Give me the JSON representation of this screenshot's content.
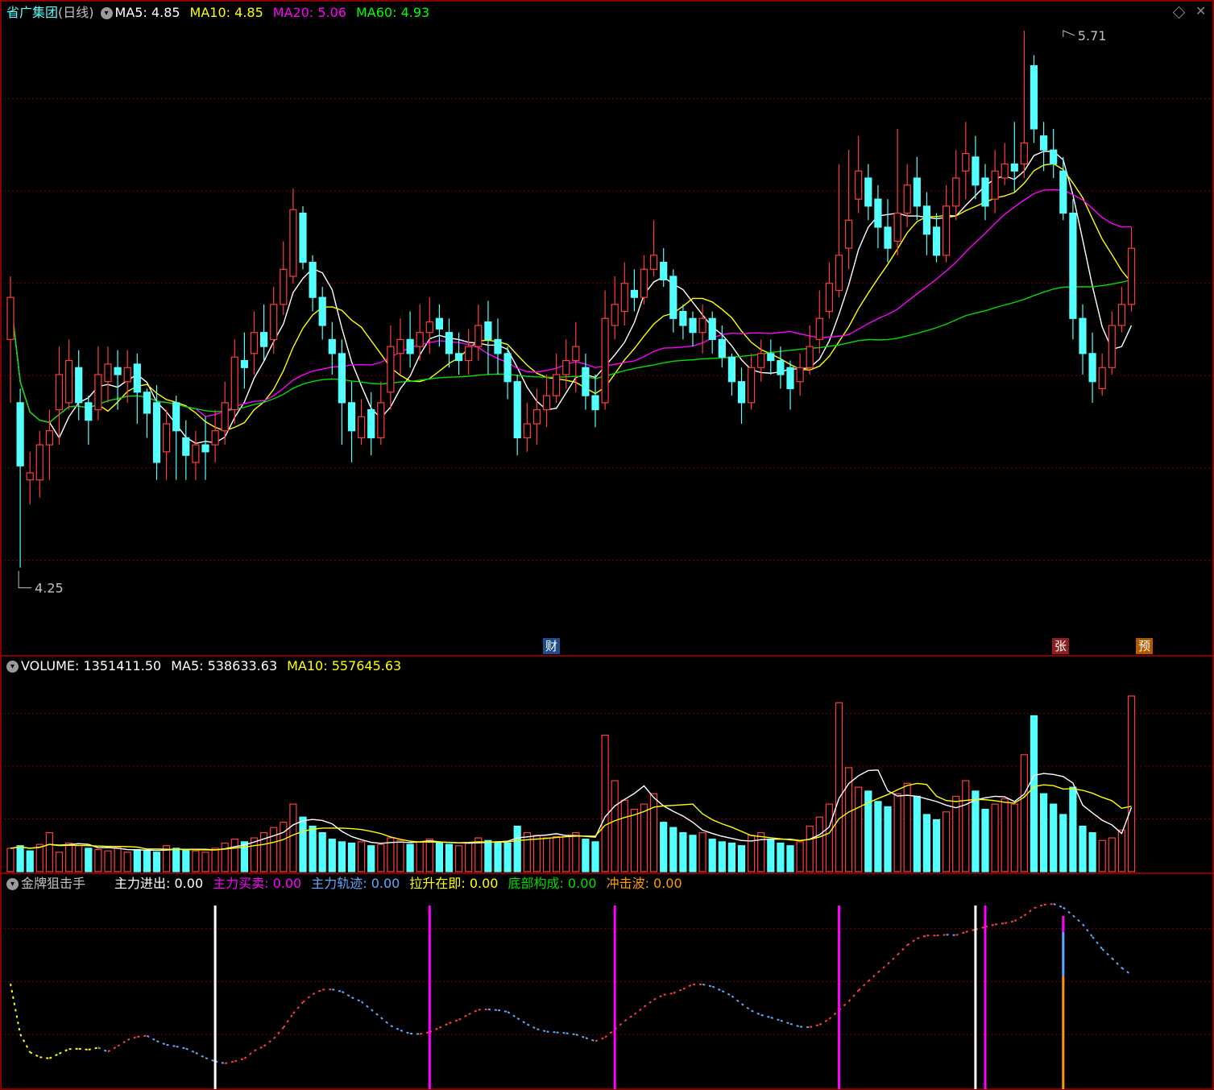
{
  "header": {
    "stock_name": "省广集团",
    "period": "(日线)",
    "ma": [
      {
        "label": "MA5: 4.85",
        "color": "#ffffff"
      },
      {
        "label": "MA10: 4.85",
        "color": "#ffff00"
      },
      {
        "label": "MA20: 5.06",
        "color": "#ff00ff"
      },
      {
        "label": "MA60: 4.93",
        "color": "#00ff00"
      }
    ]
  },
  "price_panel": {
    "high_label": "5.71",
    "low_label": "4.25",
    "markers": [
      {
        "text": "财",
        "bg": "#1f4d8c"
      },
      {
        "text": "张",
        "bg": "#8c1f1f"
      },
      {
        "text": "预",
        "bg": "#b35a00"
      }
    ]
  },
  "volume_panel": {
    "items": [
      {
        "label": "VOLUME: 1351411.50",
        "color": "#ffffff"
      },
      {
        "label": "MA5: 538633.63",
        "color": "#ffffff"
      },
      {
        "label": "MA10: 557645.63",
        "color": "#ffff00"
      }
    ]
  },
  "indicator_panel": {
    "name": "金牌狙击手",
    "items": [
      {
        "label": "主力进出: 0.00",
        "color": "#ffffff"
      },
      {
        "label": "主力买卖: 0.00",
        "color": "#ff00ff"
      },
      {
        "label": "主力轨迹: 0.00",
        "color": "#5fa8ff"
      },
      {
        "label": "拉升在即: 0.00",
        "color": "#ffff00"
      },
      {
        "label": "底部构成: 0.00",
        "color": "#00dd00"
      },
      {
        "label": "冲击波: 0.00",
        "color": "#ff9900"
      }
    ]
  },
  "colors": {
    "up": "#ff3c3c",
    "down": "#54ffff",
    "ma5": "#ffffff",
    "ma10": "#ffff00",
    "ma20": "#ff00ff",
    "ma60": "#00dd00",
    "grid": "#7a0000"
  },
  "chart_data": {
    "type": "candlestick",
    "price_range": [
      4.1,
      5.78
    ],
    "candles": [
      [
        4.9,
        5.02,
        4.72,
        5.08
      ],
      [
        4.72,
        4.54,
        4.25,
        4.76
      ],
      [
        4.5,
        4.52,
        4.43,
        4.58
      ],
      [
        4.5,
        4.6,
        4.45,
        4.64
      ],
      [
        4.6,
        4.64,
        4.5,
        4.7
      ],
      [
        4.7,
        4.8,
        4.6,
        4.88
      ],
      [
        4.72,
        4.84,
        4.7,
        4.9
      ],
      [
        4.82,
        4.72,
        4.67,
        4.87
      ],
      [
        4.72,
        4.67,
        4.6,
        4.74
      ],
      [
        4.7,
        4.8,
        4.67,
        4.88
      ],
      [
        4.78,
        4.83,
        4.72,
        4.88
      ],
      [
        4.82,
        4.8,
        4.7,
        4.87
      ],
      [
        4.78,
        4.82,
        4.72,
        4.87
      ],
      [
        4.83,
        4.75,
        4.66,
        4.86
      ],
      [
        4.75,
        4.69,
        4.62,
        4.76
      ],
      [
        4.72,
        4.55,
        4.5,
        4.77
      ],
      [
        4.58,
        4.66,
        4.5,
        4.7
      ],
      [
        4.72,
        4.64,
        4.5,
        4.74
      ],
      [
        4.62,
        4.57,
        4.5,
        4.67
      ],
      [
        4.55,
        4.6,
        4.5,
        4.64
      ],
      [
        4.6,
        4.58,
        4.5,
        4.68
      ],
      [
        4.6,
        4.64,
        4.55,
        4.7
      ],
      [
        4.64,
        4.72,
        4.6,
        4.78
      ],
      [
        4.7,
        4.85,
        4.66,
        4.9
      ],
      [
        4.84,
        4.82,
        4.76,
        4.92
      ],
      [
        4.86,
        4.92,
        4.8,
        4.98
      ],
      [
        4.92,
        4.88,
        4.84,
        5.0
      ],
      [
        4.9,
        5.0,
        4.86,
        5.05
      ],
      [
        5.0,
        5.1,
        4.97,
        5.18
      ],
      [
        5.08,
        5.27,
        5.06,
        5.33
      ],
      [
        5.26,
        5.12,
        5.1,
        5.28
      ],
      [
        5.12,
        5.02,
        4.98,
        5.14
      ],
      [
        5.02,
        4.94,
        4.9,
        5.05
      ],
      [
        4.9,
        4.86,
        4.8,
        4.95
      ],
      [
        4.86,
        4.72,
        4.6,
        4.9
      ],
      [
        4.72,
        4.64,
        4.55,
        4.78
      ],
      [
        4.62,
        4.68,
        4.6,
        4.73
      ],
      [
        4.7,
        4.62,
        4.57,
        4.75
      ],
      [
        4.62,
        4.72,
        4.6,
        4.78
      ],
      [
        4.75,
        4.88,
        4.7,
        4.94
      ],
      [
        4.86,
        4.9,
        4.8,
        4.96
      ],
      [
        4.9,
        4.86,
        4.82,
        4.98
      ],
      [
        4.88,
        4.92,
        4.84,
        5.0
      ],
      [
        4.92,
        4.95,
        4.86,
        5.02
      ],
      [
        4.96,
        4.93,
        4.88,
        5.0
      ],
      [
        4.92,
        4.86,
        4.82,
        4.96
      ],
      [
        4.86,
        4.84,
        4.8,
        4.92
      ],
      [
        4.84,
        4.88,
        4.8,
        4.93
      ],
      [
        4.88,
        4.94,
        4.84,
        5.0
      ],
      [
        4.95,
        4.9,
        4.8,
        5.01
      ],
      [
        4.9,
        4.86,
        4.8,
        4.96
      ],
      [
        4.86,
        4.78,
        4.73,
        4.88
      ],
      [
        4.78,
        4.62,
        4.57,
        4.8
      ],
      [
        4.62,
        4.66,
        4.58,
        4.72
      ],
      [
        4.66,
        4.7,
        4.6,
        4.76
      ],
      [
        4.7,
        4.74,
        4.65,
        4.8
      ],
      [
        4.74,
        4.8,
        4.72,
        4.86
      ],
      [
        4.8,
        4.84,
        4.76,
        4.9
      ],
      [
        4.84,
        4.88,
        4.75,
        4.95
      ],
      [
        4.82,
        4.74,
        4.7,
        4.86
      ],
      [
        4.74,
        4.7,
        4.65,
        4.8
      ],
      [
        4.72,
        4.96,
        4.7,
        5.04
      ],
      [
        4.94,
        5.0,
        4.9,
        5.08
      ],
      [
        4.98,
        5.06,
        4.94,
        5.12
      ],
      [
        5.04,
        5.02,
        4.98,
        5.1
      ],
      [
        5.02,
        5.1,
        5.0,
        5.14
      ],
      [
        5.1,
        5.14,
        5.08,
        5.24
      ],
      [
        5.12,
        5.07,
        5.05,
        5.16
      ],
      [
        5.08,
        4.96,
        4.92,
        5.1
      ],
      [
        4.98,
        4.94,
        4.9,
        5.0
      ],
      [
        4.96,
        4.92,
        4.88,
        4.98
      ],
      [
        4.92,
        4.96,
        4.86,
        5.0
      ],
      [
        4.96,
        4.9,
        4.86,
        4.98
      ],
      [
        4.9,
        4.85,
        4.82,
        4.94
      ],
      [
        4.85,
        4.78,
        4.74,
        4.86
      ],
      [
        4.78,
        4.72,
        4.66,
        4.82
      ],
      [
        4.72,
        4.82,
        4.7,
        4.86
      ],
      [
        4.82,
        4.86,
        4.78,
        4.9
      ],
      [
        4.86,
        4.84,
        4.8,
        4.9
      ],
      [
        4.84,
        4.8,
        4.76,
        4.88
      ],
      [
        4.82,
        4.76,
        4.7,
        4.84
      ],
      [
        4.78,
        4.82,
        4.74,
        4.86
      ],
      [
        4.82,
        4.88,
        4.8,
        4.94
      ],
      [
        4.9,
        4.96,
        4.86,
        5.04
      ],
      [
        4.98,
        5.06,
        4.96,
        5.12
      ],
      [
        5.04,
        5.14,
        5.02,
        5.4
      ],
      [
        5.16,
        5.24,
        5.1,
        5.44
      ],
      [
        5.3,
        5.38,
        5.26,
        5.48
      ],
      [
        5.36,
        5.28,
        5.24,
        5.4
      ],
      [
        5.3,
        5.22,
        5.16,
        5.34
      ],
      [
        5.22,
        5.16,
        5.12,
        5.3
      ],
      [
        5.18,
        5.26,
        5.14,
        5.5
      ],
      [
        5.26,
        5.34,
        5.22,
        5.4
      ],
      [
        5.36,
        5.28,
        5.24,
        5.42
      ],
      [
        5.28,
        5.2,
        5.14,
        5.32
      ],
      [
        5.22,
        5.14,
        5.12,
        5.26
      ],
      [
        5.14,
        5.28,
        5.12,
        5.34
      ],
      [
        5.28,
        5.36,
        5.24,
        5.44
      ],
      [
        5.38,
        5.43,
        5.3,
        5.52
      ],
      [
        5.42,
        5.34,
        5.3,
        5.48
      ],
      [
        5.36,
        5.28,
        5.24,
        5.4
      ],
      [
        5.3,
        5.38,
        5.26,
        5.44
      ],
      [
        5.36,
        5.4,
        5.34,
        5.46
      ],
      [
        5.4,
        5.38,
        5.32,
        5.52
      ],
      [
        5.4,
        5.46,
        5.36,
        5.78
      ],
      [
        5.68,
        5.5,
        5.46,
        5.71
      ],
      [
        5.48,
        5.44,
        5.38,
        5.52
      ],
      [
        5.44,
        5.4,
        5.36,
        5.5
      ],
      [
        5.38,
        5.26,
        5.24,
        5.42
      ],
      [
        5.26,
        4.96,
        4.9,
        5.3
      ],
      [
        4.96,
        4.86,
        4.8,
        5.0
      ],
      [
        4.86,
        4.78,
        4.72,
        4.92
      ],
      [
        4.76,
        4.82,
        4.74,
        4.86
      ],
      [
        4.82,
        4.94,
        4.8,
        4.98
      ],
      [
        4.94,
        5.0,
        4.92,
        5.05
      ],
      [
        5.0,
        5.16,
        4.98,
        5.22
      ]
    ],
    "volume_range": [
      0,
      1500000
    ],
    "volumes": [
      [
        180000,
        1
      ],
      [
        200000,
        0
      ],
      [
        160000,
        0
      ],
      [
        210000,
        1
      ],
      [
        300000,
        1
      ],
      [
        150000,
        1
      ],
      [
        220000,
        1
      ],
      [
        200000,
        1
      ],
      [
        180000,
        0
      ],
      [
        170000,
        1
      ],
      [
        160000,
        1
      ],
      [
        190000,
        1
      ],
      [
        150000,
        1
      ],
      [
        170000,
        0
      ],
      [
        160000,
        0
      ],
      [
        150000,
        0
      ],
      [
        200000,
        1
      ],
      [
        180000,
        0
      ],
      [
        170000,
        0
      ],
      [
        160000,
        1
      ],
      [
        150000,
        1
      ],
      [
        180000,
        1
      ],
      [
        220000,
        1
      ],
      [
        250000,
        1
      ],
      [
        230000,
        0
      ],
      [
        260000,
        1
      ],
      [
        300000,
        1
      ],
      [
        340000,
        1
      ],
      [
        380000,
        1
      ],
      [
        520000,
        1
      ],
      [
        420000,
        0
      ],
      [
        350000,
        0
      ],
      [
        300000,
        0
      ],
      [
        250000,
        0
      ],
      [
        230000,
        0
      ],
      [
        220000,
        0
      ],
      [
        230000,
        1
      ],
      [
        200000,
        0
      ],
      [
        210000,
        1
      ],
      [
        260000,
        1
      ],
      [
        240000,
        1
      ],
      [
        210000,
        0
      ],
      [
        230000,
        1
      ],
      [
        250000,
        1
      ],
      [
        220000,
        0
      ],
      [
        210000,
        0
      ],
      [
        200000,
        1
      ],
      [
        220000,
        1
      ],
      [
        260000,
        1
      ],
      [
        240000,
        0
      ],
      [
        230000,
        0
      ],
      [
        220000,
        0
      ],
      [
        350000,
        0
      ],
      [
        300000,
        1
      ],
      [
        280000,
        1
      ],
      [
        260000,
        1
      ],
      [
        270000,
        1
      ],
      [
        280000,
        1
      ],
      [
        300000,
        1
      ],
      [
        250000,
        0
      ],
      [
        230000,
        0
      ],
      [
        1050000,
        1
      ],
      [
        700000,
        1
      ],
      [
        550000,
        1
      ],
      [
        480000,
        1
      ],
      [
        520000,
        1
      ],
      [
        600000,
        1
      ],
      [
        380000,
        0
      ],
      [
        340000,
        0
      ],
      [
        300000,
        0
      ],
      [
        280000,
        0
      ],
      [
        300000,
        1
      ],
      [
        250000,
        0
      ],
      [
        230000,
        0
      ],
      [
        220000,
        0
      ],
      [
        200000,
        0
      ],
      [
        280000,
        1
      ],
      [
        300000,
        1
      ],
      [
        250000,
        0
      ],
      [
        220000,
        0
      ],
      [
        200000,
        0
      ],
      [
        230000,
        1
      ],
      [
        350000,
        1
      ],
      [
        420000,
        1
      ],
      [
        520000,
        1
      ],
      [
        1300000,
        1
      ],
      [
        800000,
        1
      ],
      [
        650000,
        1
      ],
      [
        620000,
        0
      ],
      [
        540000,
        0
      ],
      [
        500000,
        0
      ],
      [
        600000,
        1
      ],
      [
        680000,
        1
      ],
      [
        580000,
        0
      ],
      [
        440000,
        0
      ],
      [
        400000,
        0
      ],
      [
        460000,
        1
      ],
      [
        580000,
        1
      ],
      [
        700000,
        1
      ],
      [
        620000,
        0
      ],
      [
        480000,
        0
      ],
      [
        520000,
        1
      ],
      [
        560000,
        1
      ],
      [
        520000,
        1
      ],
      [
        900000,
        1
      ],
      [
        1200000,
        0
      ],
      [
        600000,
        0
      ],
      [
        520000,
        0
      ],
      [
        440000,
        0
      ],
      [
        650000,
        0
      ],
      [
        350000,
        0
      ],
      [
        300000,
        0
      ],
      [
        240000,
        1
      ],
      [
        260000,
        1
      ],
      [
        320000,
        1
      ],
      [
        1351411,
        1
      ]
    ]
  }
}
